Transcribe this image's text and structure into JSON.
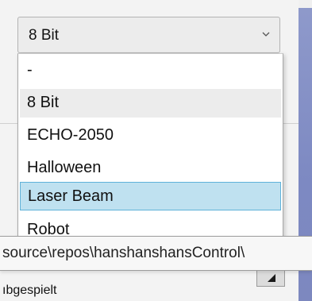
{
  "combobox": {
    "selected_value": "8 Bit",
    "chevron_icon": "chevron-down-icon"
  },
  "dropdown": {
    "items": [
      {
        "label": "-"
      },
      {
        "label": "8 Bit"
      },
      {
        "label": "ECHO-2050"
      },
      {
        "label": "Halloween"
      },
      {
        "label": "Laser Beam"
      },
      {
        "label": "Robot"
      }
    ],
    "selected_item": "8 Bit",
    "highlighted_item": "Laser Beam"
  },
  "tooltip": {
    "text": "source\\repos\\hanshanshansControl\\"
  },
  "status": {
    "text": "ıbgespielt"
  },
  "colors": {
    "highlight_fill": "#bfe1f0",
    "highlight_border": "#5fb2d9",
    "selected_fill": "#ececec",
    "side_strip": "#8f9acb"
  }
}
